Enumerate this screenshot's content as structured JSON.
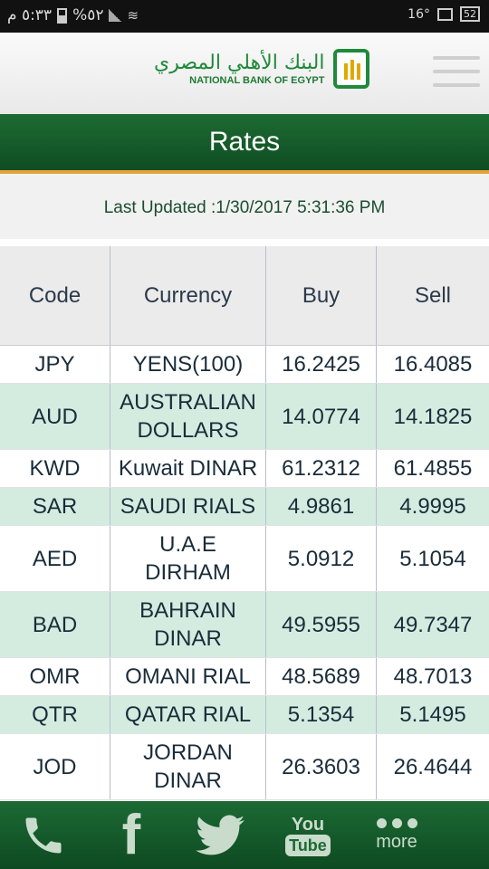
{
  "status_bar": {
    "time": "٥:٣٣ م",
    "battery": "%٥٢",
    "temperature": "16°",
    "notif_count": "52"
  },
  "header": {
    "logo_arabic": "البنك الأهلي المصري",
    "logo_english": "NATIONAL BANK OF EGYPT",
    "menu_icon": "hamburger-menu-icon"
  },
  "page": {
    "title": "Rates",
    "last_updated": "Last Updated :1/30/2017 5:31:36 PM"
  },
  "table": {
    "columns": [
      "Code",
      "Currency",
      "Buy",
      "Sell"
    ],
    "rows": [
      {
        "code": "JPY",
        "currency_l1": "YENS(100)",
        "currency_l2": "",
        "buy": "16.2425",
        "sell": "16.4085"
      },
      {
        "code": "AUD",
        "currency_l1": "AUSTRALIAN",
        "currency_l2": "DOLLARS",
        "buy": "14.0774",
        "sell": "14.1825"
      },
      {
        "code": "KWD",
        "currency_l1": "Kuwait DINAR",
        "currency_l2": "",
        "buy": "61.2312",
        "sell": "61.4855"
      },
      {
        "code": "SAR",
        "currency_l1": "SAUDI RIALS",
        "currency_l2": "",
        "buy": "4.9861",
        "sell": "4.9995"
      },
      {
        "code": "AED",
        "currency_l1": "U.A.E",
        "currency_l2": "DIRHAM",
        "buy": "5.0912",
        "sell": "5.1054"
      },
      {
        "code": "BAD",
        "currency_l1": "BAHRAIN",
        "currency_l2": "DINAR",
        "buy": "49.5955",
        "sell": "49.7347"
      },
      {
        "code": "OMR",
        "currency_l1": "OMANI RIAL",
        "currency_l2": "",
        "buy": "48.5689",
        "sell": "48.7013"
      },
      {
        "code": "QTR",
        "currency_l1": "QATAR RIAL",
        "currency_l2": "",
        "buy": "5.1354",
        "sell": "5.1495"
      },
      {
        "code": "JOD",
        "currency_l1": "JORDAN",
        "currency_l2": "DINAR",
        "buy": "26.3603",
        "sell": "26.4644"
      }
    ]
  },
  "bottom_nav": {
    "phone_icon": "phone-icon",
    "facebook_icon": "facebook-icon",
    "twitter_icon": "twitter-icon",
    "youtube_you": "You",
    "youtube_tube": "Tube",
    "more_label": "more"
  },
  "colors": {
    "brand_green": "#1d6b33",
    "accent_orange": "#e8a23b",
    "row_alt": "#d4ece0"
  }
}
